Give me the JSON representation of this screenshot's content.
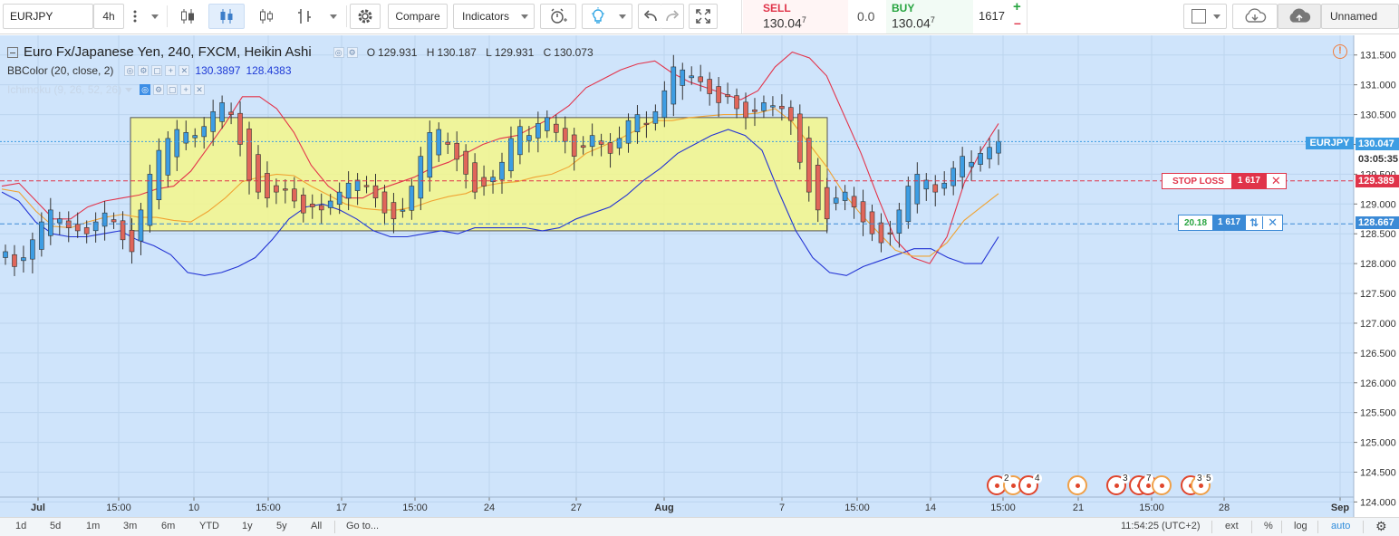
{
  "toolbar": {
    "symbol": "EURJPY",
    "interval": "4h",
    "compare_label": "Compare",
    "indicators_label": "Indicators",
    "sell_label": "SELL",
    "sell_price": "130.04",
    "sell_sup": "7",
    "spread": "0.0",
    "buy_label": "BUY",
    "buy_price": "130.04",
    "buy_sup": "7",
    "quantity": "1617",
    "plus": "+",
    "minus": "–",
    "layout_name": "Unnamed"
  },
  "legend": {
    "title": "Euro Fx/Japanese Yen, 240, FXCM, Heikin Ashi",
    "o_label": "O",
    "o": "129.931",
    "h_label": "H",
    "h": "130.187",
    "l_label": "L",
    "l": "129.931",
    "c_label": "C",
    "c": "130.073",
    "bb_name": "BBColor (20, close, 2)",
    "bb_upper": "130.3897",
    "bb_lower": "128.4383",
    "ichimoku_name": "Ichimoku (9, 26, 52, 26)"
  },
  "price_axis": {
    "ticks": [
      "131.500",
      "131.000",
      "130.500",
      "130.000",
      "129.500",
      "129.000",
      "128.500",
      "128.000",
      "127.500",
      "127.000",
      "126.500",
      "126.000",
      "125.500",
      "125.000",
      "124.500",
      "124.000"
    ],
    "last_symbol": "EURJPY",
    "last_price": "130.047",
    "countdown": "03:05:35",
    "stop_price": "129.389",
    "order_price": "128.667"
  },
  "orders": {
    "stop_label": "STOP LOSS",
    "stop_qty": "1 617",
    "pos_value": "20.18",
    "pos_qty": "1 617"
  },
  "time_axis": {
    "ticks": [
      "Jul",
      "15:00",
      "10",
      "15:00",
      "17",
      "15:00",
      "24",
      "27",
      "Aug",
      "7",
      "15:00",
      "14",
      "15:00",
      "21",
      "15:00",
      "28",
      "Sep"
    ]
  },
  "events": [
    "2",
    "4",
    "3",
    "7",
    "3",
    "5"
  ],
  "bottombar": {
    "ranges": [
      "1d",
      "5d",
      "1m",
      "3m",
      "6m",
      "YTD",
      "1y",
      "5y",
      "All"
    ],
    "goto": "Go to...",
    "clock": "11:54:25 (UTC+2)",
    "ext": "ext",
    "pct": "%",
    "log": "log",
    "auto": "auto"
  },
  "colors": {
    "chart_bg": "#cfe4fb",
    "up": "#3d9de3",
    "down": "#e0665a",
    "bb_upper": "#2333d4",
    "bb_mid": "#f0a332",
    "bb_lower": "#e3344b",
    "rectangle": "#f4f78a",
    "stop": "#e0344a",
    "order": "#3b8ad6"
  },
  "chart_data": {
    "type": "candlestick",
    "style": "Heikin Ashi",
    "ylim": [
      123.9,
      131.8
    ],
    "grid": true,
    "rectangle": {
      "y_top": 130.45,
      "y_bottom": 128.55
    },
    "hlines": [
      {
        "label": "stop",
        "y": 129.389
      },
      {
        "label": "order",
        "y": 128.667
      },
      {
        "label": "last",
        "y": 130.047
      }
    ],
    "series": [
      {
        "name": "close",
        "values": [
          128.2,
          127.95,
          128.1,
          128.4,
          128.7,
          128.9,
          128.75,
          128.6,
          128.55,
          128.5,
          128.7,
          128.85,
          128.7,
          128.4,
          128.2,
          128.9,
          129.5,
          129.9,
          130.1,
          130.25,
          130.2,
          130.15,
          130.3,
          130.55,
          130.7,
          130.5,
          130.0,
          129.4,
          129.2,
          129.1,
          129.2,
          129.25,
          129.05,
          128.85,
          128.95,
          128.9,
          129.05,
          129.2,
          129.35,
          129.4,
          129.3,
          129.1,
          128.85,
          128.75,
          128.9,
          129.3,
          129.8,
          130.2,
          130.25,
          130.0,
          129.75,
          129.5,
          129.2,
          129.3,
          129.45,
          129.7,
          130.1,
          130.3,
          130.15,
          130.35,
          130.45,
          130.2,
          130.05,
          129.8,
          129.95,
          130.15,
          130.0,
          129.85,
          130.1,
          130.4,
          130.5,
          130.35,
          130.55,
          130.9,
          131.3,
          131.25,
          131.15,
          131.05,
          130.85,
          130.7,
          130.8,
          130.6,
          130.45,
          130.55,
          130.7,
          130.65,
          130.6,
          130.4,
          129.7,
          129.2,
          128.9,
          128.75,
          129.1,
          129.2,
          128.95,
          128.7,
          128.5,
          128.35,
          128.5,
          128.9,
          129.3,
          129.5,
          129.4,
          129.2,
          129.35,
          129.6,
          129.8,
          129.7,
          129.85,
          129.95,
          130.05
        ]
      }
    ],
    "bb_upper": [
      129.3,
      129.35,
      129.05,
      128.75,
      128.75,
      128.95,
      129.05,
      129.1,
      129.15,
      129.25,
      129.3,
      129.55,
      129.95,
      130.35,
      130.8,
      130.8,
      130.6,
      130.2,
      129.65,
      129.3,
      129.1,
      129.1,
      129.25,
      129.35,
      129.45,
      129.6,
      129.7,
      129.85,
      130.0,
      130.1,
      130.15,
      130.3,
      130.45,
      130.65,
      130.95,
      131.1,
      131.25,
      131.35,
      131.4,
      131.2,
      131.05,
      130.95,
      130.85,
      130.75,
      130.9,
      131.3,
      131.55,
      131.45,
      131.15,
      130.5,
      129.85,
      129.1,
      128.4,
      128.1,
      128.0,
      128.45,
      129.35,
      129.9,
      130.35
    ],
    "bb_lower": [
      129.2,
      129.05,
      128.7,
      128.5,
      128.45,
      128.45,
      128.5,
      128.55,
      128.4,
      128.3,
      128.15,
      127.85,
      127.8,
      127.85,
      127.95,
      128.1,
      128.4,
      128.75,
      128.95,
      129.0,
      128.9,
      128.75,
      128.55,
      128.45,
      128.45,
      128.5,
      128.55,
      128.5,
      128.6,
      128.6,
      128.6,
      128.6,
      128.55,
      128.6,
      128.75,
      128.85,
      128.95,
      129.15,
      129.4,
      129.6,
      129.85,
      130.0,
      130.15,
      130.25,
      130.15,
      129.9,
      129.2,
      128.55,
      128.1,
      127.85,
      127.8,
      127.95,
      128.05,
      128.15,
      128.25,
      128.25,
      128.1,
      128.0,
      128.0,
      128.45
    ]
  }
}
